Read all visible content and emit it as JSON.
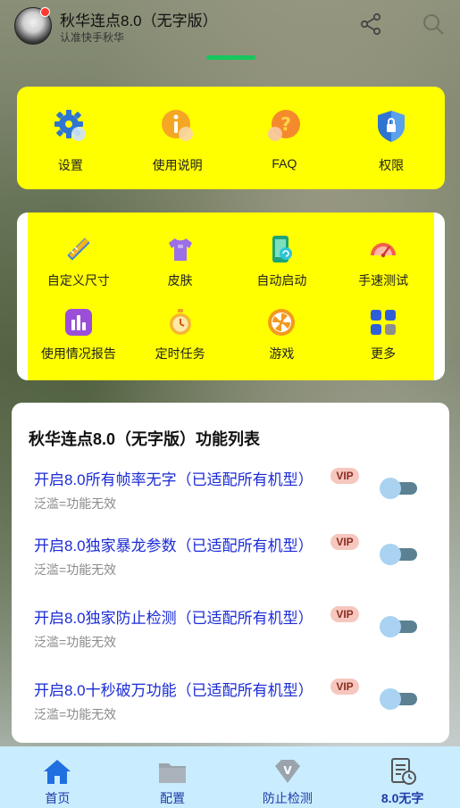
{
  "header": {
    "title": "秋华连点8.0（无字版）",
    "subtitle": "认准快手秋华",
    "avatar_icon": "anime-avatar-icon",
    "share_icon": "share-icon",
    "search_icon": "search-icon"
  },
  "quick_actions": [
    {
      "label": "设置",
      "icon": "gear-icon"
    },
    {
      "label": "使用说明",
      "icon": "info-icon"
    },
    {
      "label": "FAQ",
      "icon": "question-icon"
    },
    {
      "label": "权限",
      "icon": "shield-lock-icon"
    }
  ],
  "tools": [
    {
      "label": "自定义尺寸",
      "icon": "ruler-pencil-icon"
    },
    {
      "label": "皮肤",
      "icon": "shirt-icon"
    },
    {
      "label": "自动启动",
      "icon": "phone-auto-icon"
    },
    {
      "label": "手速测试",
      "icon": "speedometer-icon"
    },
    {
      "label": "使用情况报告",
      "icon": "bar-chart-icon"
    },
    {
      "label": "定时任务",
      "icon": "stopwatch-icon"
    },
    {
      "label": "游戏",
      "icon": "game-wheel-icon"
    },
    {
      "label": "更多",
      "icon": "grid-more-icon"
    }
  ],
  "feature_list": {
    "title": "秋华连点8.0（无字版）功能列表",
    "items": [
      {
        "title": "开启8.0所有帧率无字（已适配所有机型）",
        "badge": "VIP",
        "subtitle": "泛滥=功能无效",
        "enabled": false
      },
      {
        "title": "开启8.0独家暴龙参数（已适配所有机型）",
        "badge": "VIP",
        "subtitle": "泛滥=功能无效",
        "enabled": false
      },
      {
        "title": "开启8.0独家防止检测（已适配所有机型）",
        "badge": "VIP",
        "subtitle": "泛滥=功能无效",
        "enabled": false
      },
      {
        "title": "开启8.0十秒破万功能（已适配所有机型）",
        "badge": "VIP",
        "subtitle": "泛滥=功能无效",
        "enabled": false
      }
    ]
  },
  "bottom_nav": [
    {
      "label": "首页",
      "icon": "home-icon",
      "active": false
    },
    {
      "label": "配置",
      "icon": "folder-icon",
      "active": false
    },
    {
      "label": "防止检测",
      "icon": "diamond-v-icon",
      "active": false
    },
    {
      "label": "8.0无字",
      "icon": "clock-document-icon",
      "active": true
    }
  ],
  "colors": {
    "accent_yellow": "#ffff00",
    "link_blue": "#1b2bd6",
    "nav_bg": "#c9ecff",
    "nav_text": "#1e3aa8",
    "vip_bg": "#f6c7bf"
  }
}
